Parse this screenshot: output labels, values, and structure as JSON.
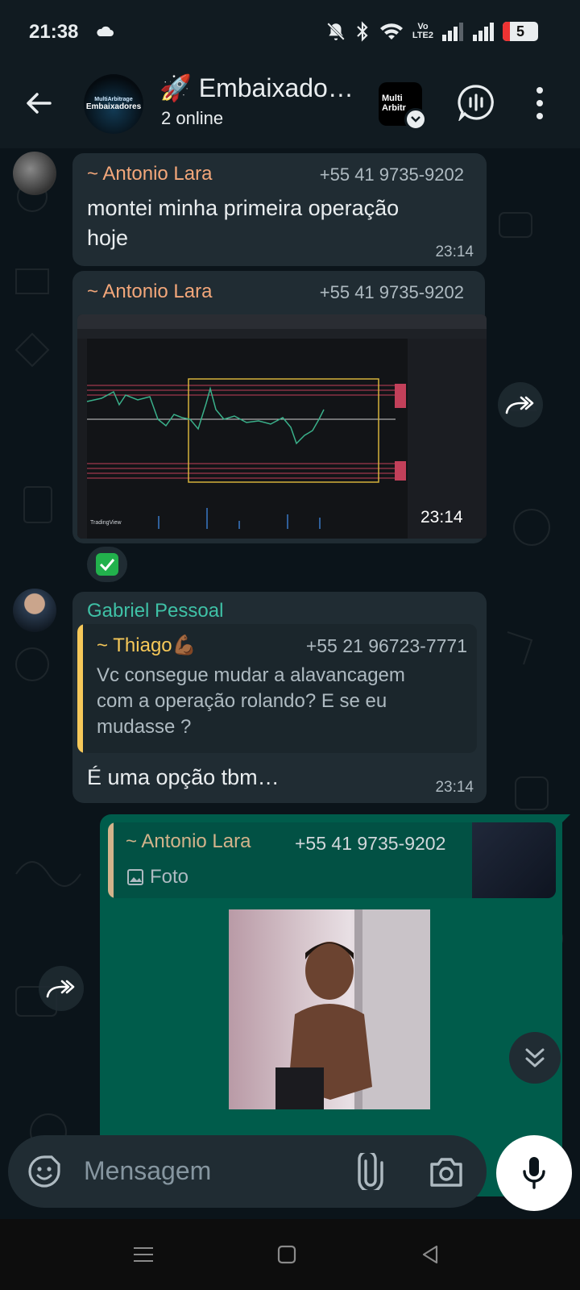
{
  "status_bar": {
    "time": "21:38",
    "network_label_top": "Vo",
    "network_label_bottom": "LTE2",
    "battery": "5",
    "icons": [
      "cloud-icon",
      "bell-off-icon",
      "bluetooth-icon",
      "wifi-icon",
      "signal-icon",
      "signal-icon",
      "battery-icon"
    ]
  },
  "header": {
    "group_avatar_small": "MultiArbitrage",
    "group_avatar_large": "Embaixadores",
    "title": "🚀 Embaixado…",
    "subtitle": "2 online",
    "app_avatar_text_1": "Multi",
    "app_avatar_text_2": "Arbitr"
  },
  "messages": {
    "m1": {
      "sender": "~ Antonio Lara",
      "phone": "+55 41 9735-9202",
      "text_line1": "montei minha primeira operação",
      "text_line2": "hoje",
      "time": "23:14"
    },
    "m2": {
      "sender": "~ Antonio Lara",
      "phone": "+55 41 9735-9202",
      "time": "23:14",
      "reaction": "✅"
    },
    "m3": {
      "sender": "Gabriel Pessoal",
      "quote_sender": "~ Thiago💪🏾",
      "quote_phone": "+55 21 96723-7771",
      "quote_line1": "Vc consegue mudar a alavancagem",
      "quote_line2": "com a operação rolando? E se eu",
      "quote_line3": "mudasse ?",
      "text": "É uma opção tbm…",
      "time": "23:14"
    },
    "m4": {
      "quote_sender": "~ Antonio Lara",
      "quote_phone": "+55 41 9735-9202",
      "quote_type": "Foto"
    }
  },
  "composer": {
    "placeholder": "Mensagem"
  },
  "colors": {
    "background": "#0b141a",
    "incoming_bubble": "#202c33",
    "outgoing_bubble": "#005c4b",
    "sender_orange": "#f3a77a",
    "sender_teal": "#53bdeb",
    "sender_green": "#3fc1a6",
    "quote_yellow": "#f6c859"
  }
}
